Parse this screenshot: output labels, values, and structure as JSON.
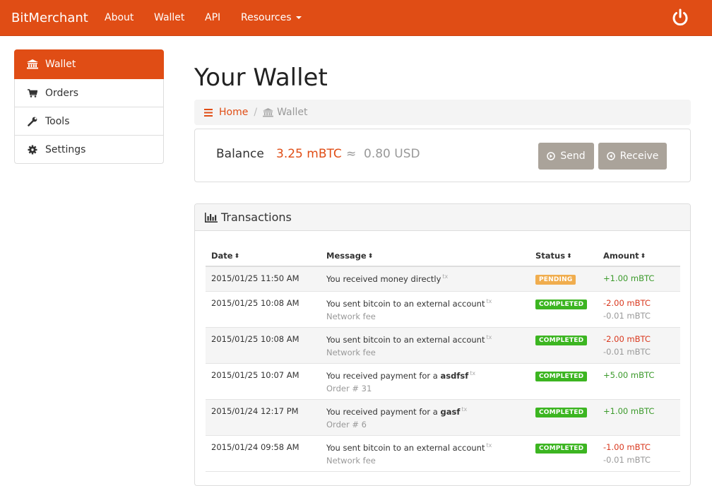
{
  "navbar": {
    "brand": "BitMerchant",
    "links": [
      "About",
      "Wallet",
      "API",
      "Resources"
    ],
    "accent": "#e04d15"
  },
  "sidebar": {
    "items": [
      {
        "label": "Wallet",
        "icon": "bank-icon",
        "active": true
      },
      {
        "label": "Orders",
        "icon": "cart-icon"
      },
      {
        "label": "Tools",
        "icon": "wrench-icon"
      },
      {
        "label": "Settings",
        "icon": "gear-icon"
      }
    ]
  },
  "main": {
    "title": "Your Wallet",
    "breadcrumb": {
      "home": "Home",
      "current": "Wallet"
    },
    "balance": {
      "label": "Balance",
      "btc": "3.25 mBTC",
      "approx": "≈",
      "usd": "0.80 USD",
      "send_label": "Send",
      "receive_label": "Receive"
    },
    "transactions": {
      "heading": "Transactions",
      "columns": [
        "Date",
        "Message",
        "Status",
        "Amount"
      ],
      "tx_tag": "tx",
      "rows": [
        {
          "date": "2015/01/25 11:50 AM",
          "message": "You received money directly",
          "bold": "",
          "sub": "",
          "status": "PENDING",
          "amount": "+1.00 mBTC",
          "fee": ""
        },
        {
          "date": "2015/01/25 10:08 AM",
          "message": "You sent bitcoin to an external account",
          "bold": "",
          "sub": "Network fee",
          "status": "COMPLETED",
          "amount": "-2.00 mBTC",
          "fee": "-0.01 mBTC"
        },
        {
          "date": "2015/01/25 10:08 AM",
          "message": "You sent bitcoin to an external account",
          "bold": "",
          "sub": "Network fee",
          "status": "COMPLETED",
          "amount": "-2.00 mBTC",
          "fee": "-0.01 mBTC"
        },
        {
          "date": "2015/01/25 10:07 AM",
          "message": "You received payment for a ",
          "bold": "asdfsf",
          "sub": "Order # 31",
          "status": "COMPLETED",
          "amount": "+5.00 mBTC",
          "fee": ""
        },
        {
          "date": "2015/01/24 12:17 PM",
          "message": "You received payment for a ",
          "bold": "gasf",
          "sub": "Order # 6",
          "status": "COMPLETED",
          "amount": "+1.00 mBTC",
          "fee": ""
        },
        {
          "date": "2015/01/24 09:58 AM",
          "message": "You sent bitcoin to an external account",
          "bold": "",
          "sub": "Network fee",
          "status": "COMPLETED",
          "amount": "-1.00 mBTC",
          "fee": "-0.01 mBTC"
        }
      ]
    }
  }
}
